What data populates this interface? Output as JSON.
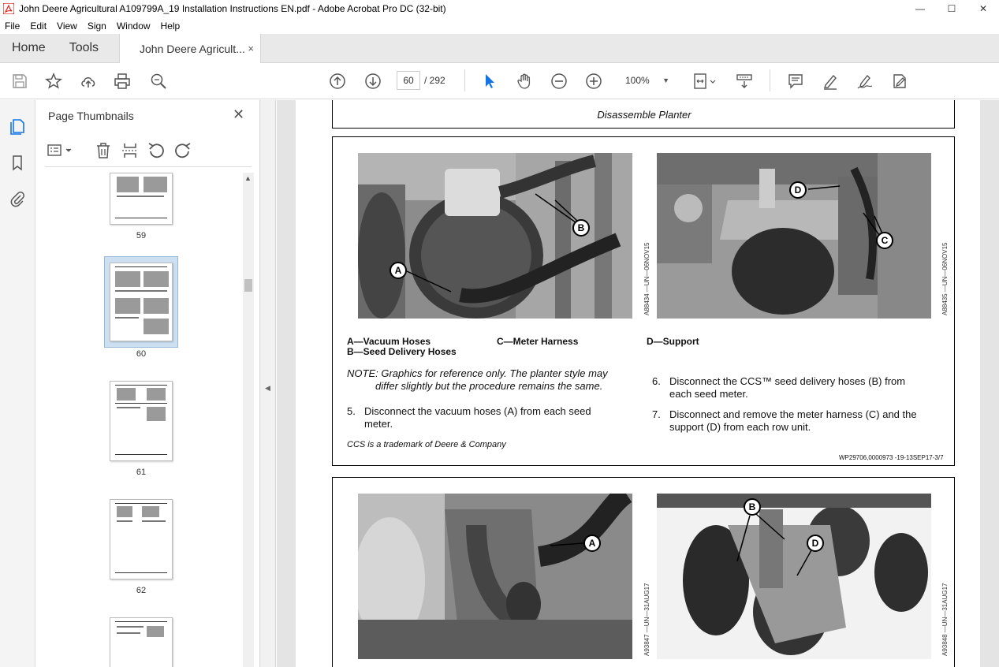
{
  "window": {
    "title": "John Deere Agricultural A109799A_19 Installation Instructions EN.pdf - Adobe Acrobat Pro DC (32-bit)",
    "minimize": "—",
    "maximize": "☐",
    "close": "✕"
  },
  "menu": [
    "File",
    "Edit",
    "View",
    "Sign",
    "Window",
    "Help"
  ],
  "tabs": {
    "home": "Home",
    "tools": "Tools",
    "document": "John Deere Agricult...",
    "close": "×"
  },
  "toolbar": {
    "page_current": "60",
    "page_total": "/ 292",
    "zoom": "100%"
  },
  "thumbnails": {
    "title": "Page Thumbnails",
    "close": "✕",
    "pages": [
      {
        "label": "59"
      },
      {
        "label": "60",
        "selected": true
      },
      {
        "label": "61"
      },
      {
        "label": "62"
      }
    ]
  },
  "document": {
    "header": "Disassemble Planter",
    "section1": {
      "photo1_id": "A88434 —UN—06NOV15",
      "photo2_id": "A88435 —UN—06NOV15",
      "callouts": [
        "A",
        "B",
        "D",
        "C"
      ],
      "legend": {
        "a": "A—Vacuum Hoses",
        "b": "B—Seed Delivery Hoses",
        "c": "C—Meter Harness",
        "d": "D—Support"
      },
      "note_line1": "NOTE: Graphics for reference only. The planter style may",
      "note_line2": "differ slightly but the procedure remains the same.",
      "steps": [
        {
          "num": "5.",
          "line1": "Disconnect the vacuum hoses (A) from each seed",
          "line2": "meter."
        },
        {
          "num": "6.",
          "line1": "Disconnect the CCS™ seed delivery hoses (B) from",
          "line2": "each seed meter."
        },
        {
          "num": "7.",
          "line1": "Disconnect and remove the meter harness (C) and the",
          "line2": "support (D) from each row unit."
        }
      ],
      "trademark": "CCS is a trademark of Deere & Company",
      "ref": "WP29706,0000973 -19-13SEP17-3/7"
    },
    "section2": {
      "photo1_id": "A93847 —UN—31AUG17",
      "photo2_id": "A93848 —UN—31AUG17",
      "callouts": [
        "A",
        "B",
        "D"
      ]
    }
  },
  "colors": {
    "accent": "#1473e6",
    "acrobat_red": "#d7251d",
    "selection": "#cde0f2"
  }
}
